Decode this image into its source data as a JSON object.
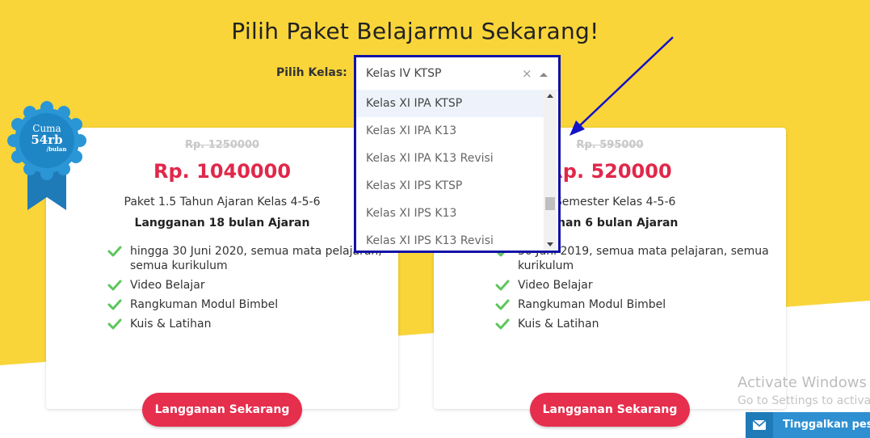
{
  "page": {
    "title": "Pilih Paket Belajarmu Sekarang!"
  },
  "kelas_selector": {
    "label": "Pilih Kelas:",
    "selected_value": "Kelas IV KTSP",
    "clear_symbol": "×",
    "options": [
      "Kelas XI IPA KTSP",
      "Kelas XI IPA K13",
      "Kelas XI IPA K13 Revisi",
      "Kelas XI IPS KTSP",
      "Kelas XI IPS K13",
      "Kelas XI IPS K13 Revisi"
    ],
    "highlighted_option_index": 0
  },
  "badge": {
    "line1": "Cuma",
    "line2": "54rb",
    "line3": "/bulan"
  },
  "plans": [
    {
      "old_price": "Rp. 1250000",
      "new_price": "Rp. 1040000",
      "description": "Paket 1.5 Tahun Ajaran Kelas 4-5-6",
      "subscription": "Langganan 18 bulan Ajaran",
      "features": [
        "hingga 30 Juni 2020, semua mata pelajaran, semua kurikulum",
        "Video Belajar",
        "Rangkuman Modul Bimbel",
        "Kuis & Latihan"
      ],
      "button_label": "Langganan Sekarang"
    },
    {
      "old_price": "Rp. 595000",
      "new_price": "Rp. 520000",
      "description": "1 Semester Kelas 4-5-6",
      "subscription": "ganan 6 bulan Ajaran",
      "features": [
        "30 Juni 2019, semua mata pelajaran, semua kurikulum",
        "Video Belajar",
        "Rangkuman Modul Bimbel",
        "Kuis & Latihan"
      ],
      "button_label": "Langganan Sekarang"
    }
  ],
  "windows_watermark": {
    "line1": "Activate Windows",
    "line2": "Go to Settings to activate"
  },
  "chat_widget": {
    "label": "Tinggalkan pesa",
    "icon": "mail-icon"
  },
  "colors": {
    "yellow": "#f9d53a",
    "price_red": "#e0284a",
    "button_red": "#e62e4d",
    "check_green": "#5cc65c",
    "badge_blue": "#2a96d6",
    "annotation_blue": "#1212c8"
  }
}
